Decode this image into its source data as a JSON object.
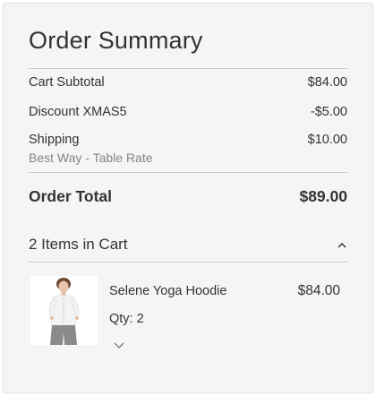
{
  "summary": {
    "title": "Order Summary",
    "cart_subtotal_label": "Cart Subtotal",
    "cart_subtotal_value": "$84.00",
    "discount_label": "Discount XMAS5",
    "discount_value": "-$5.00",
    "shipping_label": "Shipping",
    "shipping_value": "$10.00",
    "shipping_method": "Best Way - Table Rate",
    "order_total_label": "Order Total",
    "order_total_value": "$89.00"
  },
  "cart": {
    "items_label": "2 Items in Cart",
    "items": [
      {
        "name": "Selene Yoga Hoodie",
        "price": "$84.00",
        "qty_text": "Qty: 2",
        "image_icon": "product-thumbnail-hoodie"
      }
    ]
  },
  "icons": {
    "collapse": "chevron-up-icon",
    "details": "chevron-down-icon"
  },
  "colors": {
    "panel_bg": "#f5f5f5",
    "text": "#333333",
    "muted_text": "#858585",
    "divider": "#cccccc"
  }
}
